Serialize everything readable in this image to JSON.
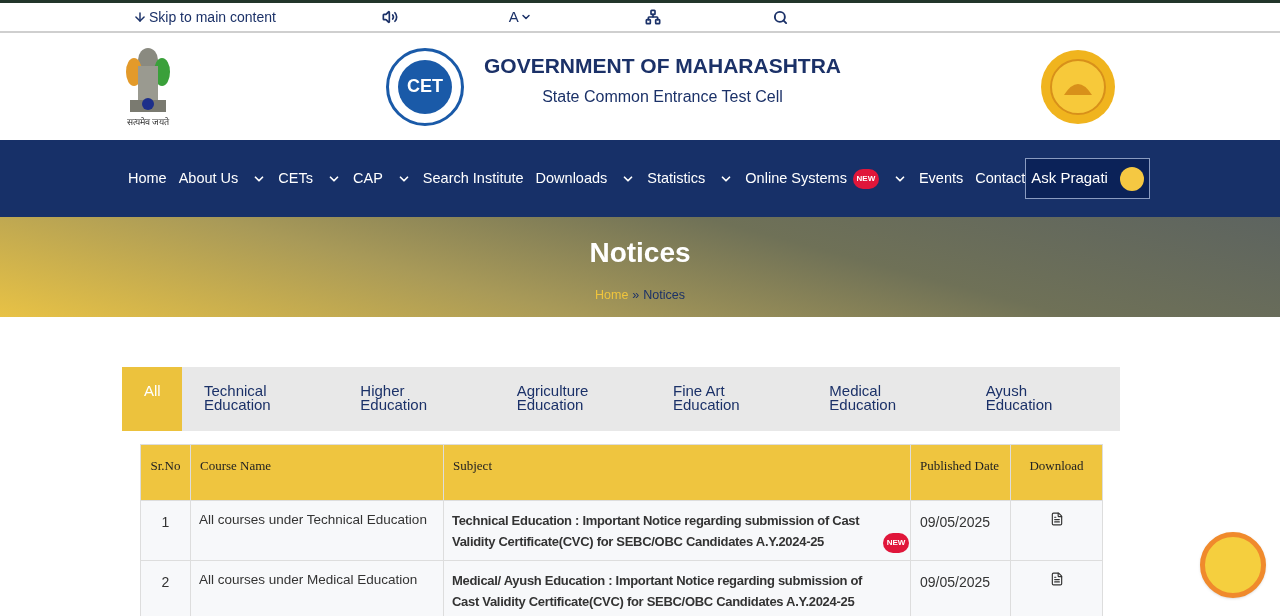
{
  "topbar": {
    "skip_link": "Skip to main content",
    "font_size_label": "A"
  },
  "header": {
    "emblem_motto": "सत्यमेव जयते",
    "logo_mark": "CET",
    "title": "GOVERNMENT OF MAHARASHTRA",
    "subtitle": "State Common Entrance Test Cell"
  },
  "nav": {
    "items": [
      {
        "label": "Home",
        "dropdown": false
      },
      {
        "label": "About Us",
        "dropdown": true
      },
      {
        "label": "CETs",
        "dropdown": true
      },
      {
        "label": "CAP",
        "dropdown": true
      },
      {
        "label": "Search Institute",
        "dropdown": false
      },
      {
        "label": "Downloads",
        "dropdown": true
      },
      {
        "label": "Statistics",
        "dropdown": true
      },
      {
        "label": "Online Systems",
        "dropdown": true,
        "badge": "NEW"
      },
      {
        "label": "Events",
        "dropdown": false
      },
      {
        "label": "Contact",
        "dropdown": false
      }
    ],
    "ask_button": "Ask Pragati"
  },
  "banner": {
    "title": "Notices",
    "breadcrumb": [
      {
        "label": "Home",
        "link": true
      },
      {
        "label": "»",
        "link": false
      },
      {
        "label": "Notices",
        "link": false
      }
    ]
  },
  "tabs": [
    {
      "label": "All",
      "selected": true
    },
    {
      "label": "Technical Education",
      "selected": false
    },
    {
      "label": "Higher Education",
      "selected": false
    },
    {
      "label": "Agriculture Education",
      "selected": false
    },
    {
      "label": "Fine Art Education",
      "selected": false
    },
    {
      "label": "Medical Education",
      "selected": false
    },
    {
      "label": "Ayush Education",
      "selected": false
    }
  ],
  "table": {
    "columns": [
      "Sr.No",
      "Course Name",
      "Subject",
      "Published Date",
      "Download"
    ],
    "rows": [
      {
        "sr": "1",
        "course": "All courses under Technical Education",
        "subject": "Technical Education : Important Notice regarding submission of Cast Validity Certificate(CVC) for SEBC/OBC Candidates A.Y.2024-25",
        "badge": "NEW",
        "date": "09/05/2025"
      },
      {
        "sr": "2",
        "course": "All courses under Medical Education",
        "subject": "Medical/ Ayush Education : Important Notice regarding submission of Cast Validity Certificate(CVC) for SEBC/OBC Candidates A.Y.2024-25",
        "date": "09/05/2025"
      }
    ]
  }
}
